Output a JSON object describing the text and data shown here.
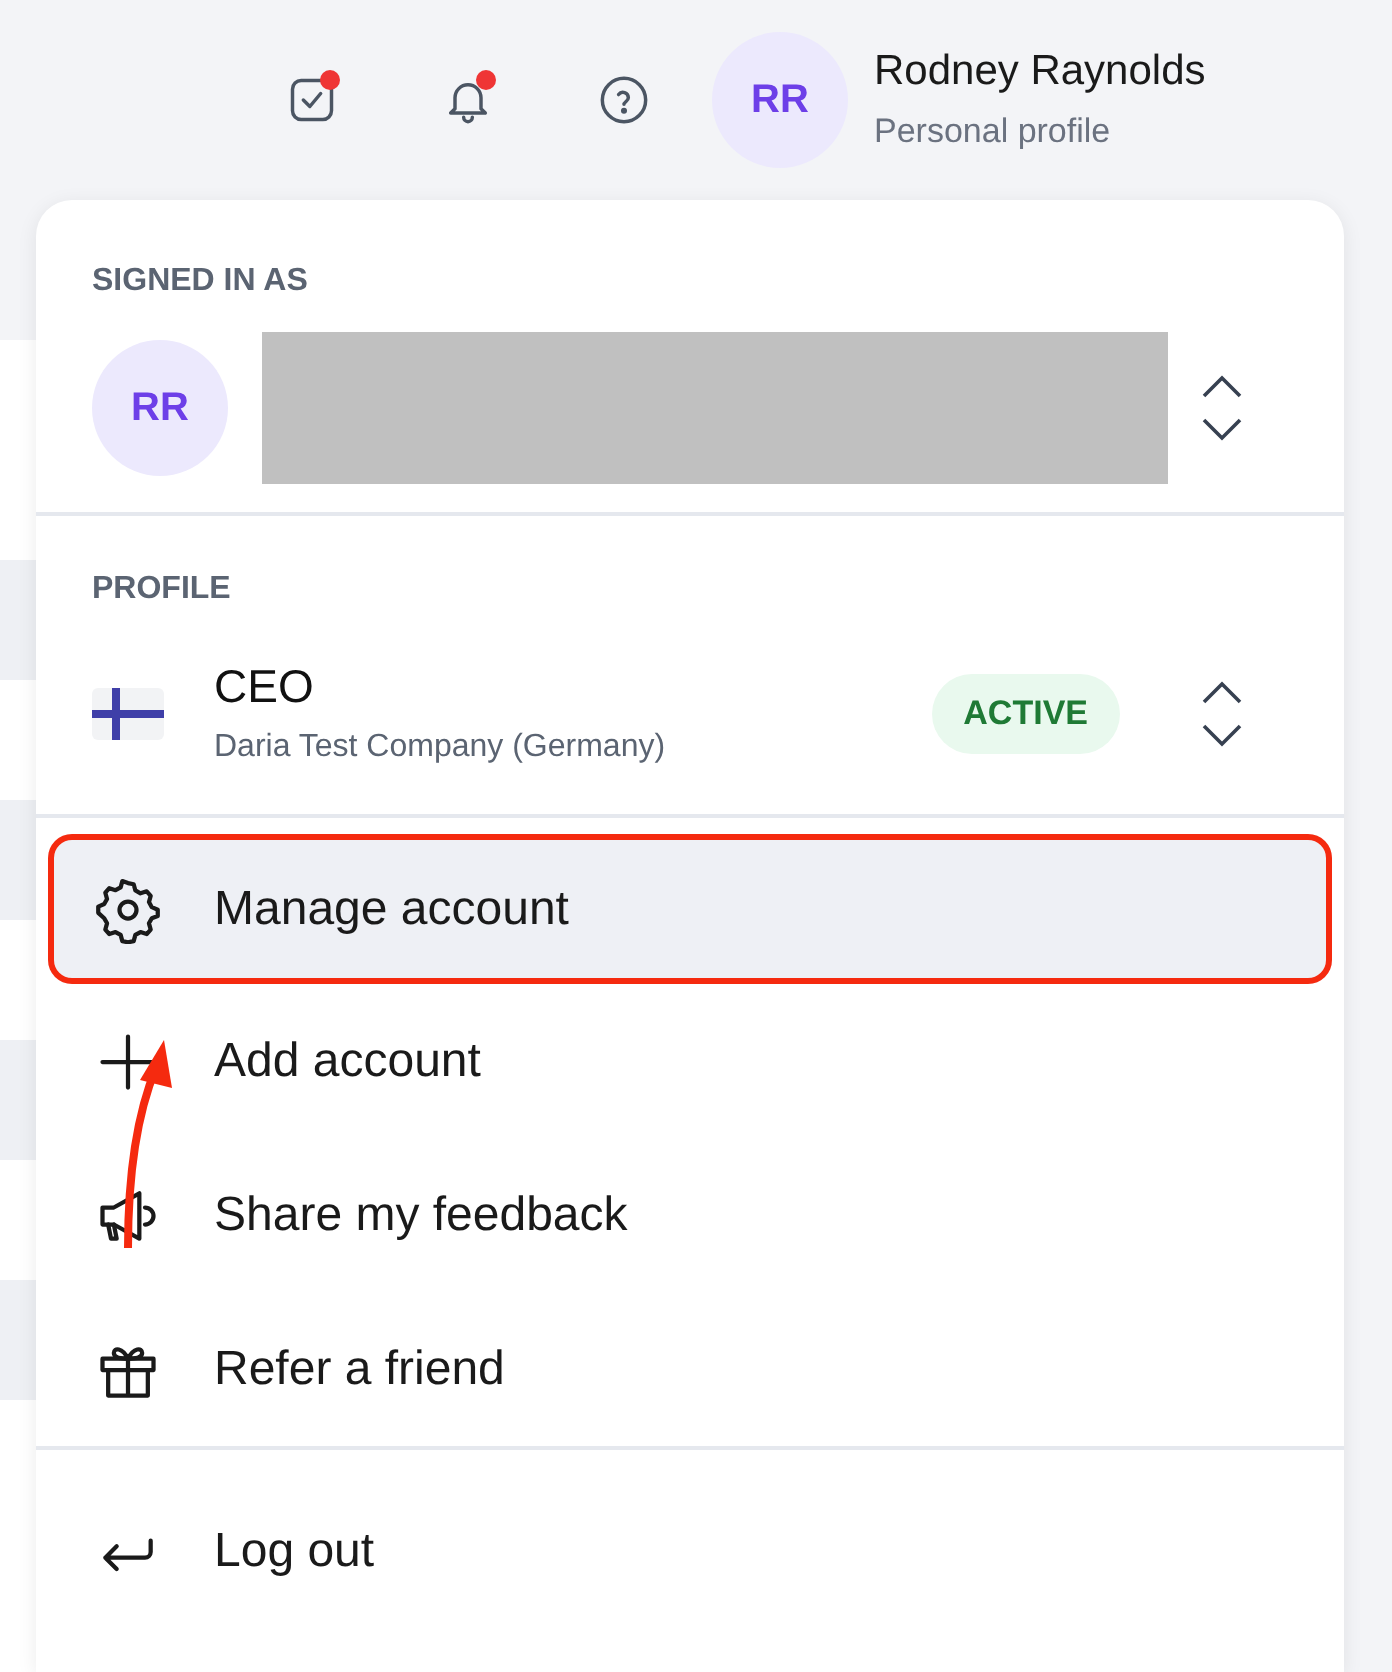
{
  "header": {
    "icons": [
      {
        "kind": "tasks",
        "badge": true
      },
      {
        "kind": "bell",
        "badge": true
      },
      {
        "kind": "help",
        "badge": false
      }
    ],
    "avatar": "RR",
    "name": "Rodney Raynolds",
    "subtitle": "Personal profile"
  },
  "signed_in": {
    "heading": "SIGNED IN AS",
    "avatar": "RR"
  },
  "profile": {
    "heading": "PROFILE",
    "role": "CEO",
    "company": "Daria Test Company (Germany)",
    "status": "ACTIVE"
  },
  "menu": [
    {
      "kind": "gear",
      "label": "Manage account",
      "selected": true,
      "highlighted": true
    },
    {
      "kind": "plus",
      "label": "Add account",
      "selected": false,
      "highlighted": false
    },
    {
      "kind": "megaphone",
      "label": "Share my feedback",
      "selected": false,
      "highlighted": false
    },
    {
      "kind": "gift",
      "label": "Refer a friend",
      "selected": false,
      "highlighted": false
    }
  ],
  "footer_menu": [
    {
      "kind": "logout",
      "label": "Log out"
    }
  ]
}
